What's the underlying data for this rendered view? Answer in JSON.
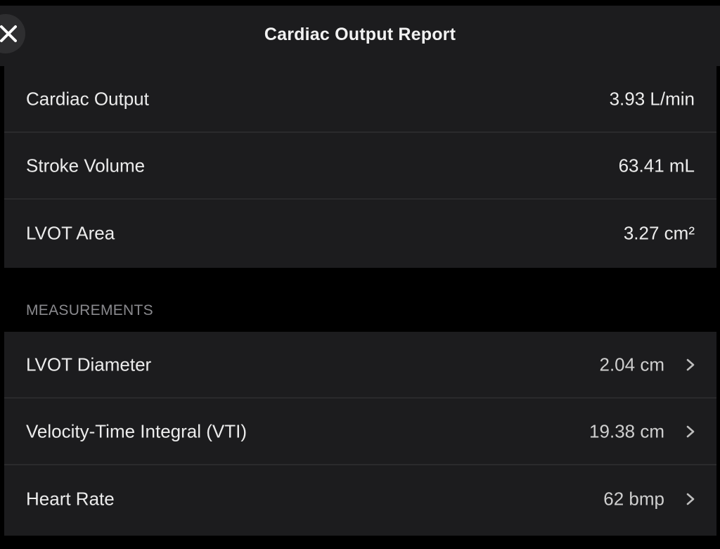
{
  "header": {
    "title": "Cardiac Output Report",
    "close_icon": "close-icon"
  },
  "summary": {
    "rows": [
      {
        "label": "Cardiac Output",
        "value": "3.93 L/min"
      },
      {
        "label": "Stroke Volume",
        "value": "63.41 mL"
      },
      {
        "label": "LVOT Area",
        "value": "3.27 cm²"
      }
    ]
  },
  "measurements": {
    "section_title": "MEASUREMENTS",
    "rows": [
      {
        "label": "LVOT Diameter",
        "value": "2.04 cm",
        "icon": "chevron-right-icon"
      },
      {
        "label": "Velocity-Time Integral (VTI)",
        "value": "19.38 cm",
        "icon": "chevron-right-icon"
      },
      {
        "label": "Heart Rate",
        "value": "62 bmp",
        "icon": "chevron-right-icon"
      }
    ]
  },
  "colors": {
    "background": "#000000",
    "surface": "#1c1c1e",
    "divider": "#2a2a2c",
    "text_primary": "#ececec",
    "text_secondary": "#8a8a8e"
  }
}
